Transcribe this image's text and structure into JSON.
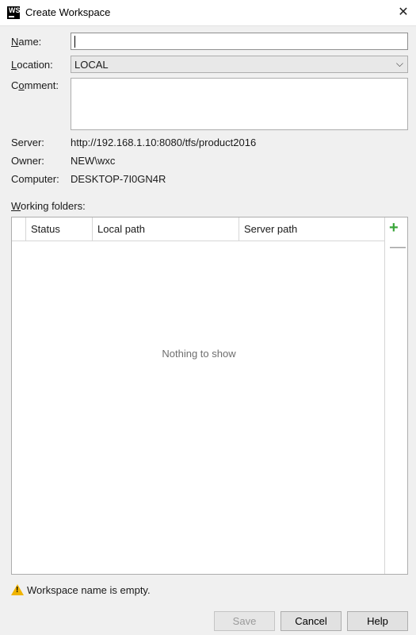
{
  "window": {
    "title": "Create Workspace",
    "icon_text": "WS",
    "close_glyph": "✕"
  },
  "form": {
    "name_label_mn": "N",
    "name_label_rest": "ame:",
    "location_label_mn": "L",
    "location_label_rest": "ocation:",
    "comment_label_pre": "C",
    "comment_label_mn": "o",
    "comment_label_rest": "mment:",
    "name_value": "",
    "location_value": "LOCAL",
    "comment_value": ""
  },
  "info": {
    "server_label": "Server:",
    "server_value": "http://192.168.1.10:8080/tfs/product2016",
    "owner_label": "Owner:",
    "owner_value": "NEW\\wxc",
    "computer_label": "Computer:",
    "computer_value": "DESKTOP-7I0GN4R"
  },
  "working_folders": {
    "label_mn": "W",
    "label_rest": "orking folders:",
    "columns": [
      "Status",
      "Local path",
      "Server path"
    ],
    "empty_text": "Nothing to show",
    "add_glyph": "+",
    "remove_glyph": "—"
  },
  "status": {
    "warning_text": "Workspace name is empty.",
    "icon": "warning-icon",
    "warning_color": "#f0b400"
  },
  "buttons": {
    "save": "Save",
    "cancel": "Cancel",
    "help": "Help"
  }
}
